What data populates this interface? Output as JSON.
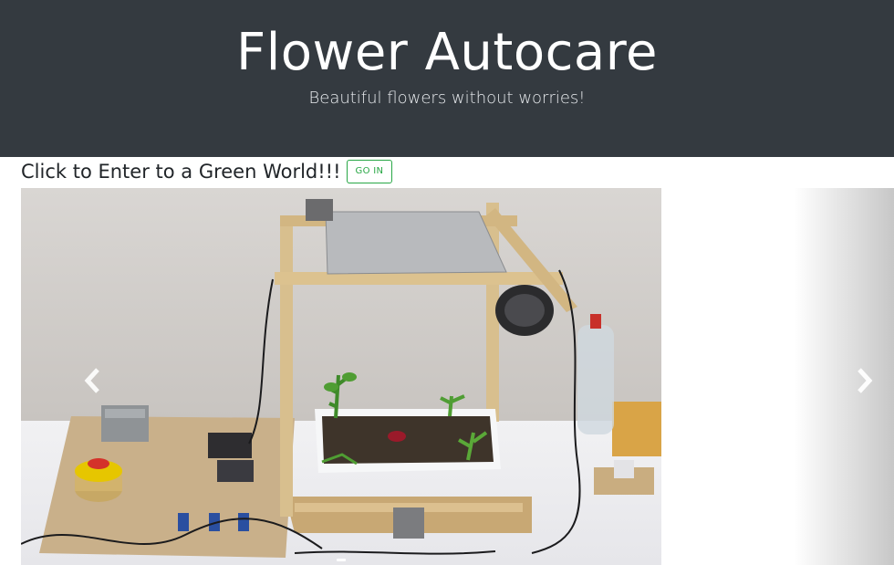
{
  "header": {
    "title": "Flower Autocare",
    "subtitle": "Beautiful flowers without worries!"
  },
  "cta": {
    "text": "Click to Enter to a Green World!!!",
    "button_label": "GO IN",
    "button_color": "#28a745"
  },
  "carousel": {
    "prev_icon": "chevron-left-icon",
    "next_icon": "chevron-right-icon",
    "slide_count": 1
  },
  "colors": {
    "header_bg": "#343a40",
    "page_bg": "#ffffff"
  }
}
